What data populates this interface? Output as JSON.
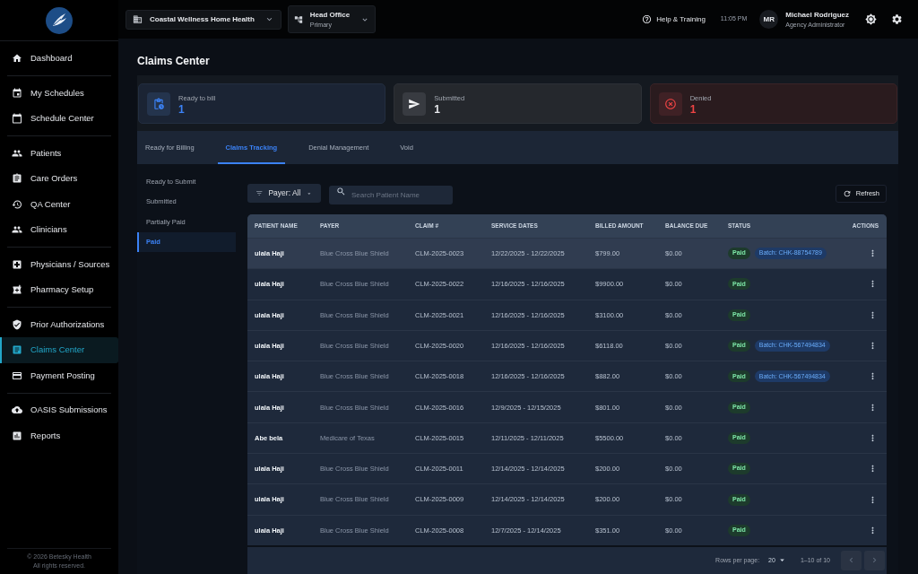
{
  "sidebar": {
    "groups": [
      {
        "items": [
          {
            "label": "Dashboard",
            "selected": false
          }
        ]
      },
      {
        "items": [
          {
            "label": "My Schedules",
            "selected": false
          },
          {
            "label": "Schedule Center",
            "selected": false
          }
        ]
      },
      {
        "items": [
          {
            "label": "Patients",
            "selected": false
          },
          {
            "label": "Care Orders",
            "selected": false
          },
          {
            "label": "QA Center",
            "selected": false
          },
          {
            "label": "Clinicians",
            "selected": false
          }
        ]
      },
      {
        "items": [
          {
            "label": "Physicians / Sources",
            "selected": false
          },
          {
            "label": "Pharmacy Setup",
            "selected": false
          }
        ]
      },
      {
        "items": [
          {
            "label": "Prior Authorizations",
            "selected": false
          },
          {
            "label": "Claims Center",
            "selected": true
          },
          {
            "label": "Payment Posting",
            "selected": false
          }
        ]
      },
      {
        "items": [
          {
            "label": "OASIS Submissions",
            "selected": false
          },
          {
            "label": "Reports",
            "selected": false
          }
        ]
      }
    ],
    "footer": [
      "© 2026 Betesky Health",
      "All rights reserved."
    ]
  },
  "top_bar": {
    "organization": "Coastal Wellness Home Health",
    "branch": {
      "name": "Head Office",
      "type": "Primary"
    },
    "help": "Help & Training",
    "time": "11:05 PM",
    "user": {
      "initials": "MR",
      "name": "Michael Rodriguez",
      "role": "Agency Administrator"
    }
  },
  "page_title": "Claims Center",
  "stats": [
    {
      "kind": "info",
      "label": "Ready to bill",
      "value": "1"
    },
    {
      "kind": "neutral",
      "label": "Submitted",
      "value": "1"
    },
    {
      "kind": "danger",
      "label": "Denied",
      "value": "1"
    }
  ],
  "tabs": [
    {
      "label": "Ready for Billing",
      "selected": false
    },
    {
      "label": "Claims Tracking",
      "selected": true
    },
    {
      "label": "Denial Management",
      "selected": false
    },
    {
      "label": "Void",
      "selected": false
    }
  ],
  "sub_nav": [
    {
      "label": "Ready to Submit",
      "selected": false
    },
    {
      "label": "Submitted",
      "selected": false
    },
    {
      "label": "Partially Paid",
      "selected": false
    },
    {
      "label": "Paid",
      "selected": true
    }
  ],
  "toolbar": {
    "payer_filter": "Payer: All",
    "search": {
      "placeholder": "Search Patient Name"
    },
    "refresh": "Refresh"
  },
  "table": {
    "columns": [
      "PATIENT NAME",
      "PAYER",
      "CLAIM #",
      "SERVICE DATES",
      "BILLED AMOUNT",
      "BALANCE DUE",
      "STATUS",
      "ACTIONS"
    ],
    "rows": [
      {
        "hovered": true,
        "patient": "ulala Haji",
        "payer": "Blue Cross Blue Shield",
        "claim": "CLM-2025-0023",
        "service_dates": "12/22/2025 - 12/22/2025",
        "billed": "$799.00",
        "balance": "$0.00",
        "status": {
          "kind": "paid",
          "label": "Paid"
        },
        "batch": "Batch: CHK-88754789"
      },
      {
        "hovered": false,
        "patient": "ulala Haji",
        "payer": "Blue Cross Blue Shield",
        "claim": "CLM-2025-0022",
        "service_dates": "12/16/2025 - 12/16/2025",
        "billed": "$9900.00",
        "balance": "$0.00",
        "status": {
          "kind": "paid",
          "label": "Paid"
        }
      },
      {
        "hovered": false,
        "patient": "ulala Haji",
        "payer": "Blue Cross Blue Shield",
        "claim": "CLM-2025-0021",
        "service_dates": "12/16/2025 - 12/16/2025",
        "billed": "$3100.00",
        "balance": "$0.00",
        "status": {
          "kind": "paid",
          "label": "Paid"
        }
      },
      {
        "hovered": false,
        "patient": "ulala Haji",
        "payer": "Blue Cross Blue Shield",
        "claim": "CLM-2025-0020",
        "service_dates": "12/16/2025 - 12/16/2025",
        "billed": "$6118.00",
        "balance": "$0.00",
        "status": {
          "kind": "paid",
          "label": "Paid"
        },
        "batch": "Batch: CHK-567494834"
      },
      {
        "hovered": false,
        "patient": "ulala Haji",
        "payer": "Blue Cross Blue Shield",
        "claim": "CLM-2025-0018",
        "service_dates": "12/16/2025 - 12/16/2025",
        "billed": "$882.00",
        "balance": "$0.00",
        "status": {
          "kind": "paid",
          "label": "Paid"
        },
        "batch": "Batch: CHK-567494834"
      },
      {
        "hovered": false,
        "patient": "ulala Haji",
        "payer": "Blue Cross Blue Shield",
        "claim": "CLM-2025-0016",
        "service_dates": "12/9/2025 - 12/15/2025",
        "billed": "$801.00",
        "balance": "$0.00",
        "status": {
          "kind": "paid",
          "label": "Paid"
        }
      },
      {
        "hovered": false,
        "patient": "Abe bela",
        "payer": "Medicare of Texas",
        "claim": "CLM-2025-0015",
        "service_dates": "12/11/2025 - 12/11/2025",
        "billed": "$5500.00",
        "balance": "$0.00",
        "status": {
          "kind": "paid",
          "label": "Paid"
        }
      },
      {
        "hovered": false,
        "patient": "ulala Haji",
        "payer": "Blue Cross Blue Shield",
        "claim": "CLM-2025-0011",
        "service_dates": "12/14/2025 - 12/14/2025",
        "billed": "$200.00",
        "balance": "$0.00",
        "status": {
          "kind": "paid",
          "label": "Paid"
        }
      },
      {
        "hovered": false,
        "patient": "ulala Haji",
        "payer": "Blue Cross Blue Shield",
        "claim": "CLM-2025-0009",
        "service_dates": "12/14/2025 - 12/14/2025",
        "billed": "$200.00",
        "balance": "$0.00",
        "status": {
          "kind": "paid",
          "label": "Paid"
        }
      },
      {
        "hovered": false,
        "patient": "ulala Haji",
        "payer": "Blue Cross Blue Shield",
        "claim": "CLM-2025-0008",
        "service_dates": "12/7/2025 - 12/14/2025",
        "billed": "$351.00",
        "balance": "$0.00",
        "status": {
          "kind": "paid",
          "label": "Paid"
        }
      }
    ]
  },
  "pagination": {
    "rows_per_page_label": "Rows per page:",
    "rows_per_page": "20",
    "range": "1–10 of 10",
    "prev": {
      "disabled": true
    },
    "next": {
      "disabled": true
    }
  }
}
